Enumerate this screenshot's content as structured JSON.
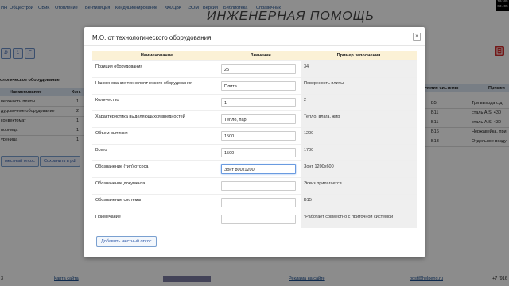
{
  "topnav": {
    "items": [
      "ИН",
      "Общестрой",
      "ОВиК",
      "Отопление",
      "Вентиляция",
      "Кондиционирование",
      "ФК/ЦВК",
      "ЭОМ",
      "Версия",
      "Библиотека",
      "Справочник"
    ],
    "clock_time": "10:05",
    "clock_date": "03.05"
  },
  "background": {
    "banner": "ИНЖЕНЕРНАЯ ПОМОЩЬ",
    "toolbar": [
      "D",
      "L",
      "F"
    ],
    "heading": "ологическое оборудование",
    "table_head": [
      "Наименование",
      "Кол."
    ],
    "rows": [
      {
        "name": "верхность плиты",
        "qty": "1"
      },
      {
        "name": "дудовочное оборудование",
        "qty": "2"
      },
      {
        "name": "конвектомат",
        "qty": "1"
      },
      {
        "name": "порница",
        "qty": "1"
      },
      {
        "name": "уреница",
        "qty": "1"
      }
    ],
    "btn_local": "местный отсос",
    "btn_pdf": "Сохранить в pdf",
    "right_head": [
      "ачение системы",
      "Примеч"
    ],
    "right_rows": [
      {
        "sys": "В5",
        "note": "Три выхода с д"
      },
      {
        "sys": "В11",
        "note": "сталь AISI 430"
      },
      {
        "sys": "В11",
        "note": "сталь AISI 430"
      },
      {
        "sys": "В16",
        "note": "Нержавейка, при"
      },
      {
        "sys": "В13",
        "note": "Отдельное возду"
      }
    ]
  },
  "footer": {
    "left_num": "3",
    "map_link": "Карта сайта",
    "ads_link": "Реклама на сайте",
    "email": "post@helpeng.ru",
    "phone": "+7 (916"
  },
  "modal": {
    "title": "М.О. от технологического оборудования",
    "close": "×",
    "columns": [
      "Наименование",
      "Значение",
      "Пример заполнения"
    ],
    "rows": [
      {
        "label": "Позиция оборудования",
        "value": "25",
        "example": "34"
      },
      {
        "label": "Наименование технологического оборудования",
        "value": "Плита",
        "example": "Поверхность плиты"
      },
      {
        "label": "Количество",
        "value": "1",
        "example": "2"
      },
      {
        "label": "Характеристика выделяющихся вредностей",
        "value": "Тепло, пар",
        "example": "Тепло, влага, жир"
      },
      {
        "label": "Объем вытяжки",
        "value": "1500",
        "example": "1200"
      },
      {
        "label": "Всего",
        "value": "1500",
        "example": "1700"
      },
      {
        "label": "Обозначение (тип) отсоса",
        "value": "Зонт 800х1200",
        "example": "Зонт 1200х600"
      },
      {
        "label": "Обозначение документа",
        "value": "",
        "example": "Эскиз прилагается"
      },
      {
        "label": "Обозначение системы",
        "value": "",
        "example": "В15"
      },
      {
        "label": "Примечание",
        "value": "",
        "example": "*Работает совместно с приточной системой"
      }
    ],
    "add_button": "Добавить местный отсос"
  }
}
